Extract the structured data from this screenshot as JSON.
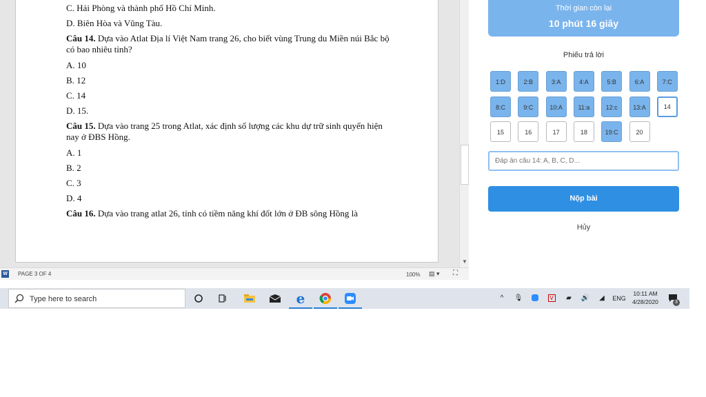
{
  "document": {
    "lines": [
      "C. Hải Phòng và thành phố Hồ Chí Minh.",
      "D. Biên Hòa và Vũng Tàu."
    ],
    "q14": {
      "label": "Câu 14.",
      "text": " Dựa vào Atlat Địa lí Việt Nam trang 26, cho biết vùng Trung du Miền núi Bắc bộ có bao nhiêu tỉnh?"
    },
    "q14_options": [
      "A. 10",
      "B. 12",
      "C. 14",
      "D. 15."
    ],
    "q15": {
      "label": "Câu 15.",
      "text": " Dựa vào trang 25 trong Atlat, xác định số lượng các khu dự trữ sinh quyển hiện nay ở ĐBS Hồng."
    },
    "q15_options": [
      "A. 1",
      "B. 2",
      "C. 3",
      "D. 4"
    ],
    "q16": {
      "label": "Câu 16.",
      "text": " Dựa vào trang atlat 26, tỉnh có tiềm năng khí đốt lớn ở ĐB sông Hồng là"
    }
  },
  "word_status": {
    "page": "PAGE 3 OF 4",
    "zoom": "100%",
    "logo": "W"
  },
  "quiz": {
    "timer_label": "Thời gian còn lại",
    "timer_value": "10 phút 16 giây",
    "sheet_title": "Phiếu trả lời",
    "answers": [
      {
        "label": "1:D",
        "state": "answered"
      },
      {
        "label": "2:B",
        "state": "answered"
      },
      {
        "label": "3:A",
        "state": "answered"
      },
      {
        "label": "4:A",
        "state": "answered"
      },
      {
        "label": "5:B",
        "state": "answered"
      },
      {
        "label": "6:A",
        "state": "answered"
      },
      {
        "label": "7:C",
        "state": "answered"
      },
      {
        "label": "8:C",
        "state": "answered"
      },
      {
        "label": "9:C",
        "state": "answered"
      },
      {
        "label": "10:A",
        "state": "answered"
      },
      {
        "label": "11:a",
        "state": "answered"
      },
      {
        "label": "12:c",
        "state": "answered"
      },
      {
        "label": "13:A",
        "state": "answered"
      },
      {
        "label": "14",
        "state": "current"
      },
      {
        "label": "15",
        "state": "empty"
      },
      {
        "label": "16",
        "state": "empty"
      },
      {
        "label": "17",
        "state": "empty"
      },
      {
        "label": "18",
        "state": "empty"
      },
      {
        "label": "19:C",
        "state": "answered"
      },
      {
        "label": "20",
        "state": "empty"
      }
    ],
    "input_placeholder": "Đáp án câu 14: A, B, C, D...",
    "submit_label": "Nộp bài",
    "cancel_label": "Hủy",
    "accent_color": "#7ab4ec",
    "submit_color": "#2f8fe3"
  },
  "taskbar": {
    "search_placeholder": "Type here to search",
    "apps": [
      "cortana-icon",
      "task-view-icon",
      "file-explorer-icon",
      "mail-icon",
      "edge-icon",
      "chrome-icon",
      "zoom-icon"
    ],
    "language": "ENG",
    "time": "10:11 AM",
    "date": "4/28/2020",
    "notification_count": "3"
  }
}
